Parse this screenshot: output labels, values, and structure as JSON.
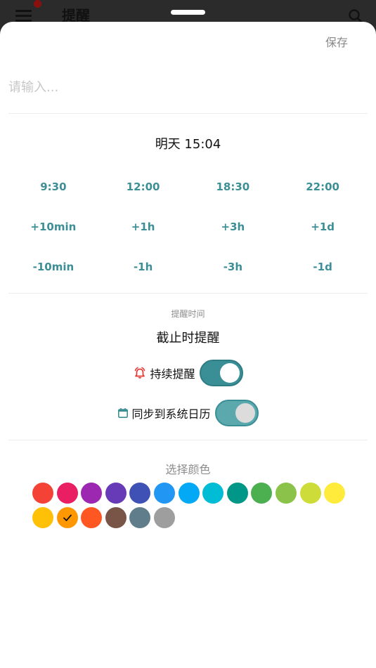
{
  "app": {
    "title": "提醒"
  },
  "sheet": {
    "save_label": "保存",
    "input_placeholder": "请输入...",
    "input_value": "",
    "datetime": "明天 15:04",
    "presets": [
      [
        "9:30",
        "12:00",
        "18:30",
        "22:00"
      ],
      [
        "+10min",
        "+1h",
        "+3h",
        "+1d"
      ],
      [
        "-10min",
        "-1h",
        "-3h",
        "-1d"
      ]
    ],
    "reminder_time_caption": "提醒时间",
    "deadline_label": "截止时提醒",
    "persistent": {
      "label": "持续提醒",
      "on": true,
      "icon": "alarm-bell-icon",
      "icon_color": "#e53935"
    },
    "calendar_sync": {
      "label": "同步到系统日历",
      "on": true,
      "enabled": false,
      "icon": "calendar-icon",
      "icon_color": "#3d8f96"
    },
    "color_title": "选择颜色",
    "colors": [
      "#f44336",
      "#e91e63",
      "#9c27b0",
      "#673ab7",
      "#3f51b5",
      "#2196f3",
      "#03a9f4",
      "#00bcd4",
      "#009688",
      "#4caf50",
      "#8bc34a",
      "#cddc39",
      "#ffeb3b",
      "#ffc107",
      "#ff9800",
      "#ff5722",
      "#795548",
      "#607d8b",
      "#9e9e9e"
    ],
    "selected_color": "#ff9800",
    "accent": "#3d8f96"
  }
}
